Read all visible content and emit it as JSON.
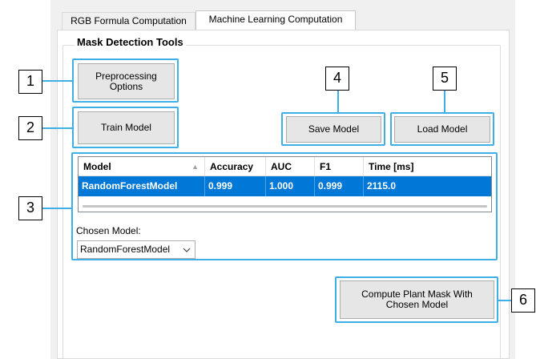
{
  "tabs": [
    {
      "label": "RGB Formula Computation",
      "active": false
    },
    {
      "label": "Machine Learning Computation",
      "active": true
    }
  ],
  "group": {
    "title": "Mask Detection Tools"
  },
  "buttons": {
    "preprocessing_line1": "Preprocessing",
    "preprocessing_line2": "Options",
    "train": "Train Model",
    "save": "Save Model",
    "load": "Load Model",
    "compute_line1": "Compute Plant Mask With",
    "compute_line2": "Chosen Model"
  },
  "table": {
    "columns": [
      "Model",
      "Accuracy",
      "AUC",
      "F1",
      "Time [ms]"
    ],
    "sort_column": "Model",
    "rows": [
      [
        "RandomForestModel",
        "0.999",
        "1.000",
        "0.999",
        "2115.0"
      ]
    ]
  },
  "chosen_model": {
    "label": "Chosen Model:",
    "value": "RandomForestModel"
  },
  "callouts": [
    "1",
    "2",
    "3",
    "4",
    "5",
    "6"
  ],
  "colors": {
    "highlight": "#3fb0e6",
    "selection": "#0078d7"
  }
}
